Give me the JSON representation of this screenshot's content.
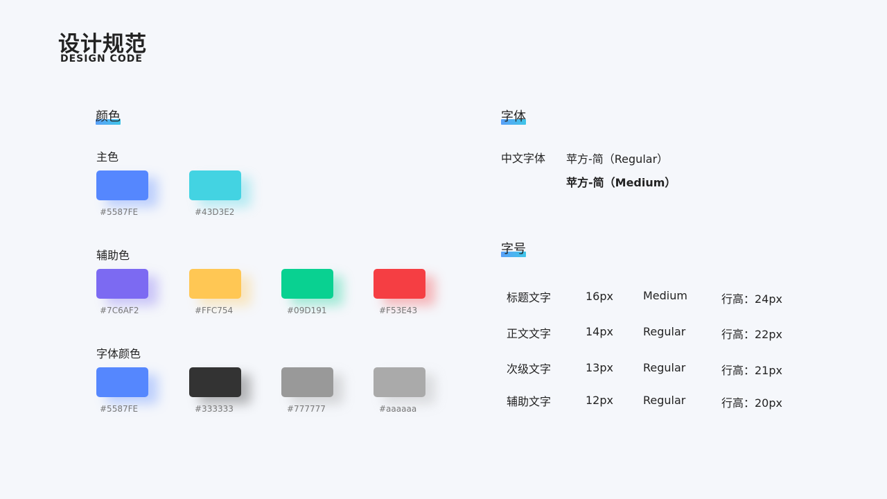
{
  "header": {
    "title": "设计规范",
    "subtitle": "DESIGN CODE"
  },
  "colors": {
    "section_title": "颜色",
    "groups": [
      {
        "label": "主色",
        "swatches": [
          {
            "hex": "#5587FE",
            "code": "#5587FE"
          },
          {
            "hex": "#43D3E2",
            "code": "#43D3E2"
          }
        ]
      },
      {
        "label": "辅助色",
        "swatches": [
          {
            "hex": "#7C6AF2",
            "code": "#7C6AF2"
          },
          {
            "hex": "#FFC754",
            "code": "#FFC754"
          },
          {
            "hex": "#09D191",
            "code": "#09D191"
          },
          {
            "hex": "#F53E43",
            "code": "#F53E43"
          }
        ]
      },
      {
        "label": "字体颜色",
        "swatches": [
          {
            "hex": "#5587FE",
            "code": "#5587FE"
          },
          {
            "hex": "#333333",
            "code": "#333333"
          },
          {
            "hex": "#999999",
            "code": "#777777"
          },
          {
            "hex": "#aaaaaa",
            "code": "#aaaaaa"
          }
        ]
      }
    ]
  },
  "fonts": {
    "section_title": "字体",
    "label": "中文字体",
    "samples": [
      "苹方-简（Regular）",
      "苹方-简（Medium）"
    ]
  },
  "sizes": {
    "section_title": "字号",
    "rows": [
      {
        "name": "标题文字",
        "size": "16px",
        "weight": "Medium",
        "line": "行高：24px"
      },
      {
        "name": "正文文字",
        "size": "14px",
        "weight": "Regular",
        "line": "行高：22px"
      },
      {
        "name": "次级文字",
        "size": "13px",
        "weight": "Regular",
        "line": "行高：21px"
      },
      {
        "name": "辅助文字",
        "size": "12px",
        "weight": "Regular",
        "line": "行高：20px"
      }
    ]
  }
}
